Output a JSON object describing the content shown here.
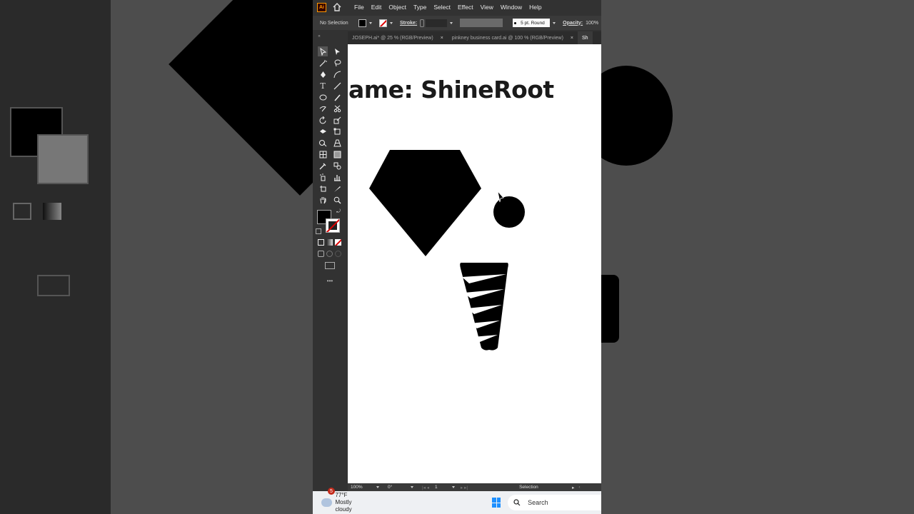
{
  "menubar": {
    "logo": "Ai",
    "items": [
      "File",
      "Edit",
      "Object",
      "Type",
      "Select",
      "Effect",
      "View",
      "Window",
      "Help"
    ]
  },
  "controlbar": {
    "selection": "No Selection",
    "stroke_label": "Stroke:",
    "brush": "5 pt. Round",
    "opacity_label": "Opacity:",
    "opacity_value": "100%"
  },
  "tabs": [
    {
      "label": "JOSEPH.ai* @ 25 % (RGB/Preview)",
      "close": "×"
    },
    {
      "label": "pinkney business card.ai @ 100 % (RGB/Preview)",
      "close": "×"
    },
    {
      "label": "Sh",
      "close": ""
    }
  ],
  "canvas": {
    "heading": "ame: ShineRoot"
  },
  "statusbar": {
    "zoom": "100%",
    "rotation": "0°",
    "artboard": "1",
    "tool": "Selection"
  },
  "taskbar": {
    "badge": "5",
    "temperature": "77°F",
    "condition": "Mostly cloudy",
    "search_placeholder": "Search"
  },
  "colors": {
    "accent": "#ff9a00",
    "windows_blue": "#1e90ff"
  }
}
